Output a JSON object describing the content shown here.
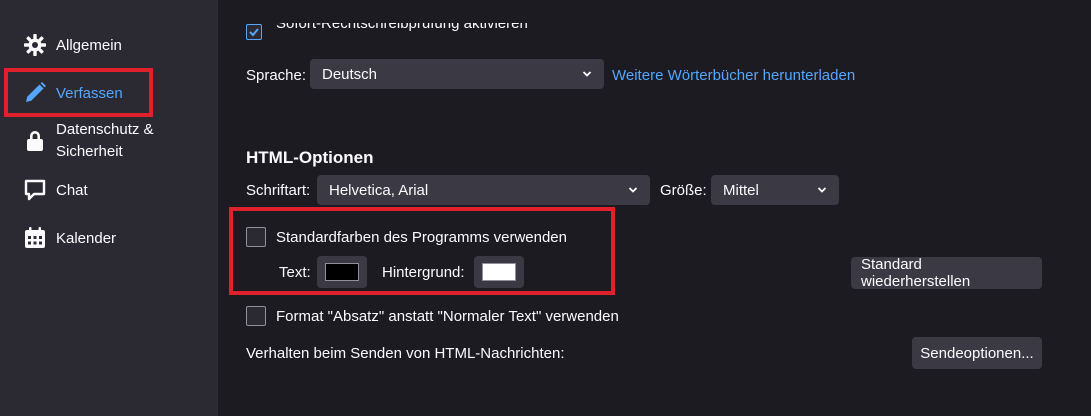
{
  "sidebar": {
    "items": [
      {
        "label": "Allgemein",
        "icon": "gear-icon"
      },
      {
        "label": "Verfassen",
        "icon": "pencil-icon",
        "active": true
      },
      {
        "label_line1": "Datenschutz &",
        "label_line2": "Sicherheit",
        "icon": "lock-icon"
      },
      {
        "label": "Chat",
        "icon": "chat-icon"
      },
      {
        "label": "Kalender",
        "icon": "calendar-icon"
      }
    ]
  },
  "spell": {
    "label": "Sofort-Rechtschreibprüfung aktivieren"
  },
  "language": {
    "label": "Sprache:",
    "value": "Deutsch",
    "link": "Weitere Wörterbücher herunterladen"
  },
  "html_options": {
    "heading": "HTML-Optionen",
    "font_label": "Schriftart:",
    "font_value": "Helvetica, Arial",
    "size_label": "Größe:",
    "size_value": "Mittel",
    "default_colors_label": "Standardfarben des Programms verwenden",
    "text_label": "Text:",
    "text_color": "#000000",
    "background_label": "Hintergrund:",
    "background_color": "#ffffff",
    "restore_button": "Standard wiederherstellen",
    "paragraph_label": "Format \"Absatz\" anstatt \"Normaler Text\" verwenden",
    "send_behavior_label": "Verhalten beim Senden von HTML-Nachrichten:",
    "send_options_button": "Sendeoptionen..."
  },
  "colors": {
    "accent": "#54a6ff",
    "highlight": "#e0202c",
    "background": "#1c1b22",
    "sidebar": "#2b2a33",
    "control": "#3a3944"
  }
}
